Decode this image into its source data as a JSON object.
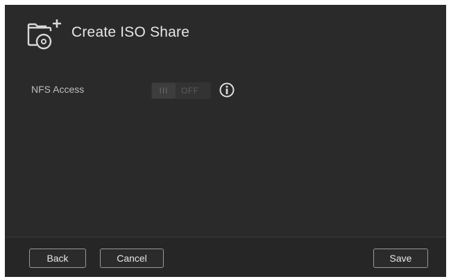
{
  "dialog": {
    "title": "Create ISO Share",
    "icon": "iso-share-add-icon"
  },
  "nfs": {
    "label": "NFS Access",
    "toggle_handle": "III",
    "toggle_state": "OFF",
    "info_icon": "info-icon"
  },
  "footer": {
    "back_label": "Back",
    "cancel_label": "Cancel",
    "save_label": "Save"
  },
  "colors": {
    "background": "#2a2a2a",
    "text": "#e6e6e6",
    "button_border": "#9a9a9a"
  }
}
